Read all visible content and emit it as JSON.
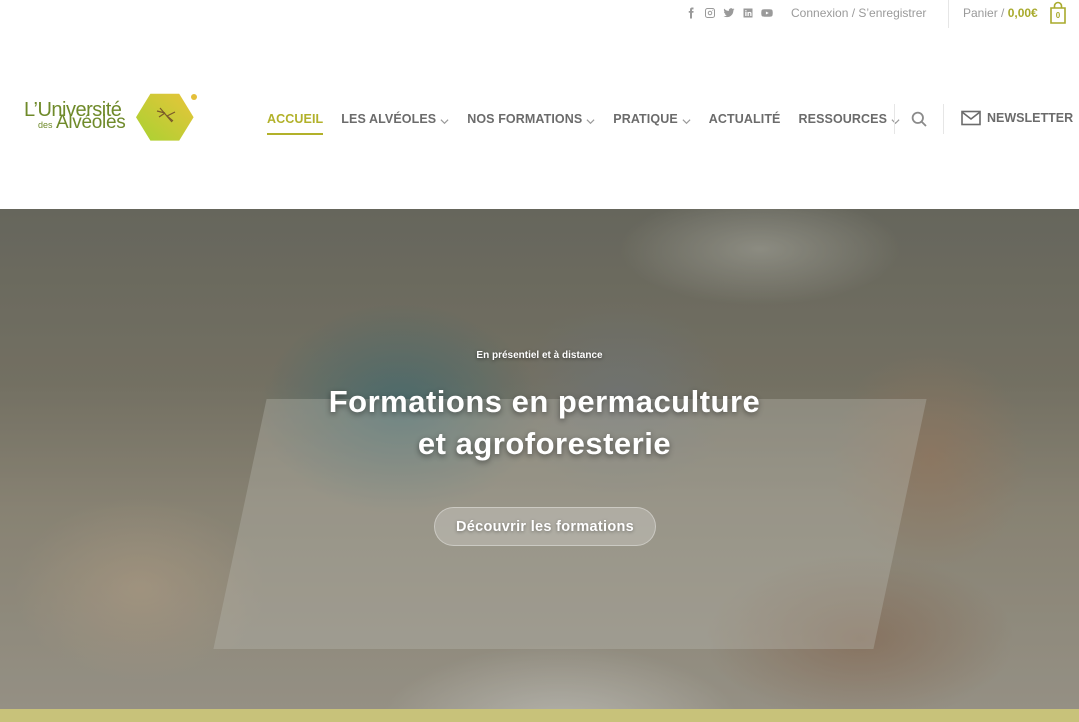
{
  "topbar": {
    "social_icons": [
      "facebook-icon",
      "instagram-icon",
      "twitter-icon",
      "linkedin-icon",
      "youtube-icon"
    ],
    "login_label": "Connexion / S’enregistrer",
    "cart_label": "Panier /",
    "cart_amount": "0,00€",
    "cart_count": "0"
  },
  "logo": {
    "line1": "L’Université",
    "line2": "des",
    "line3": "Alvéoles"
  },
  "nav": {
    "items": [
      {
        "label": "ACCUEIL",
        "has_dropdown": false,
        "active": true
      },
      {
        "label": "LES ALVÉOLES",
        "has_dropdown": true
      },
      {
        "label": "NOS FORMATIONS",
        "has_dropdown": true
      },
      {
        "label": "PRATIQUE",
        "has_dropdown": true
      },
      {
        "label": "ACTUALITÉ",
        "has_dropdown": false
      },
      {
        "label": "RESSOURCES",
        "has_dropdown": true
      }
    ],
    "newsletter_label": "NEWSLETTER"
  },
  "hero": {
    "kicker": "En présentiel et à distance",
    "title_line1": "Formations en permaculture",
    "title_line2": "et agroforesterie",
    "button_label": "Découvrir les formations"
  },
  "colors": {
    "accent": "#b2b12a",
    "logo_green": "#6f8a2a",
    "text_gray": "#6b6b6b"
  }
}
